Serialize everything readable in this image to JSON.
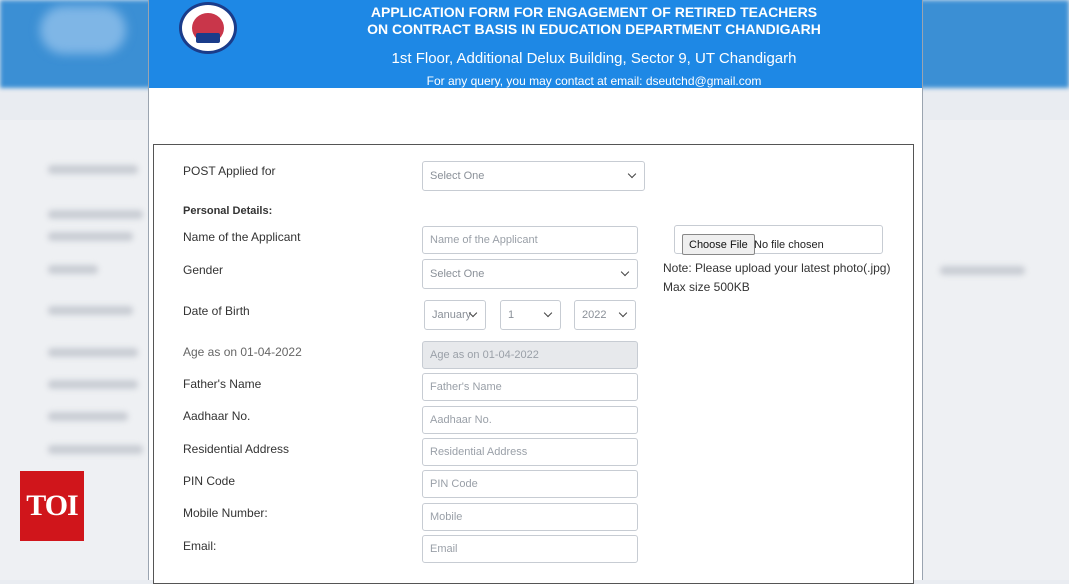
{
  "header": {
    "title_line1": "APPLICATION FORM FOR ENGAGEMENT OF RETIRED TEACHERS",
    "title_line2": "ON CONTRACT BASIS IN EDUCATION DEPARTMENT CHANDIGARH",
    "address": "1st Floor, Additional Delux Building, Sector 9, UT Chandigarh",
    "query": "For any query, you may contact at email: dseutchd@gmail.com"
  },
  "form": {
    "post_label": "POST Applied for",
    "post_select": "Select One",
    "personal_details": "Personal Details:",
    "name_label": "Name of the Applicant",
    "name_placeholder": "Name of the Applicant",
    "gender_label": "Gender",
    "gender_select": "Select One",
    "dob_label": "Date of Birth",
    "dob_month": "January",
    "dob_day": "1",
    "dob_year": "2022",
    "age_label": "Age as on 01-04-2022",
    "age_placeholder": "Age as on 01-04-2022",
    "father_label": "Father's Name",
    "father_placeholder": "Father's Name",
    "aadhaar_label": "Aadhaar No.",
    "aadhaar_placeholder": "Aadhaar No.",
    "address_label": "Residential Address",
    "address_placeholder": "Residential Address",
    "pin_label": "PIN Code",
    "pin_placeholder": "PIN Code",
    "mobile_label": "Mobile Number:",
    "mobile_placeholder": "Mobile",
    "email_label": "Email:",
    "email_placeholder": "Email"
  },
  "photo": {
    "choose_file": "Choose File",
    "no_file": "No file chosen",
    "note_line1": "Note: Please upload your latest photo(.jpg)",
    "note_line2": "Max size 500KB"
  },
  "watermark": {
    "brand": "TOI",
    "brand_color": "#d0151b"
  },
  "colors": {
    "header_blue": "#1e88e5"
  }
}
